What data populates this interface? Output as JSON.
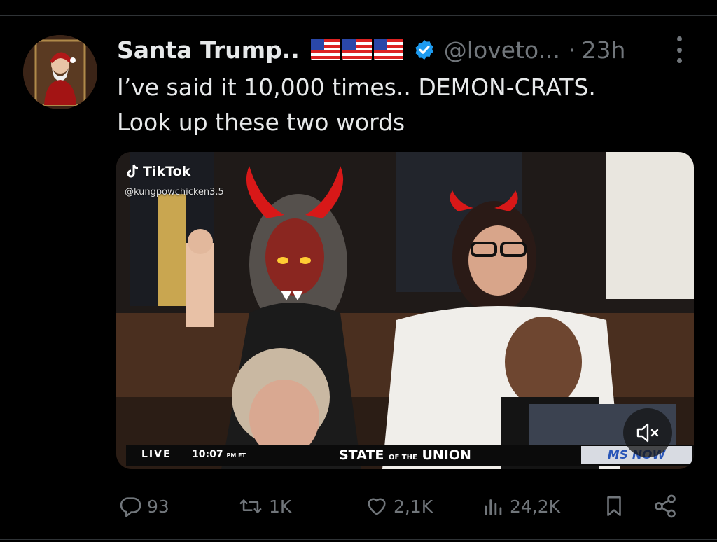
{
  "tweet": {
    "author_name": "Santa Trump..",
    "handle": "@loveto...",
    "separator": "·",
    "time": "23h",
    "text_lines": [
      "I’ve said it 10,000 times.. DEMON-CRATS.",
      "Look up these two words"
    ]
  },
  "media": {
    "watermark_brand": "TikTok",
    "watermark_user": "@kungpowchicken3.5",
    "ticker_live": "LIVE",
    "ticker_time": "10:07",
    "ticker_time_zone": "PM ET",
    "ticker_title_a": "STATE",
    "ticker_title_of": "OF THE",
    "ticker_title_b": "UNION",
    "network_logo": "MS NOW"
  },
  "actions": {
    "replies": "93",
    "reposts": "1K",
    "likes": "2,1K",
    "views": "24,2K"
  },
  "colors": {
    "background": "#000000",
    "text": "#e7e9ea",
    "muted": "#71767b",
    "verified": "#1d9bf0"
  },
  "icons": [
    "verified-badge-icon",
    "more-icon",
    "reply-icon",
    "repost-icon",
    "like-icon",
    "views-icon",
    "bookmark-icon",
    "share-icon",
    "mute-icon",
    "tiktok-icon"
  ]
}
